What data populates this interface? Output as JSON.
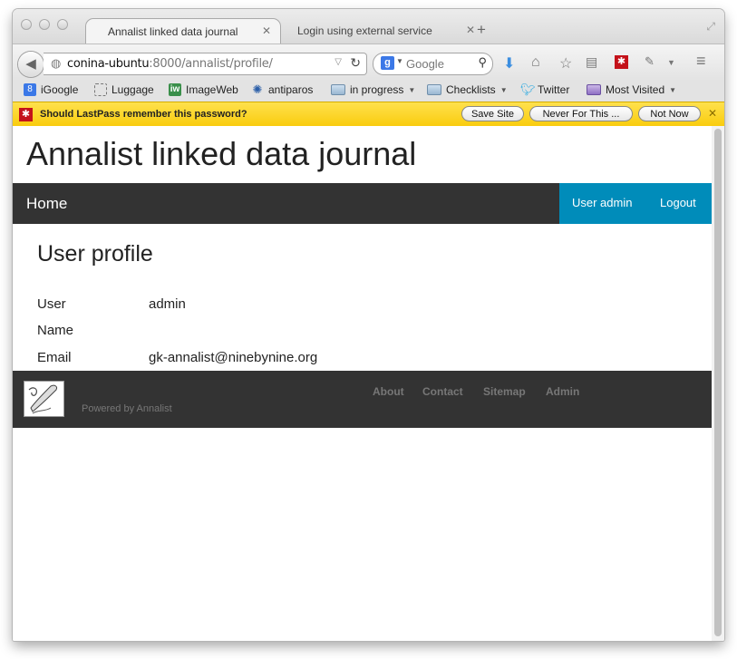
{
  "browser": {
    "tabs": [
      {
        "label": "Annalist linked data journal",
        "active": true
      },
      {
        "label": "Login using external service",
        "active": false
      }
    ],
    "url_host": "conina-ubuntu",
    "url_rest": ":8000/annalist/profile/",
    "search_placeholder": "Google",
    "search_engine_badge": "g"
  },
  "bookmarks": [
    {
      "label": "iGoogle",
      "icon": "igoogle-icon"
    },
    {
      "label": "Luggage",
      "icon": "luggage-icon"
    },
    {
      "label": "ImageWeb",
      "icon": "imageweb-icon"
    },
    {
      "label": "antiparos",
      "icon": "antiparos-icon"
    },
    {
      "label": "in progress",
      "icon": "folder-icon"
    },
    {
      "label": "Checklists",
      "icon": "folder-icon"
    },
    {
      "label": "Twitter",
      "icon": "twitter-icon"
    },
    {
      "label": "Most Visited",
      "icon": "most-visited-icon"
    }
  ],
  "lastpass": {
    "message": "Should LastPass remember this password?",
    "buttons": [
      "Save Site",
      "Never For This ...",
      "Not Now"
    ]
  },
  "page": {
    "site_title": "Annalist linked data journal",
    "nav": {
      "home": "Home",
      "user_admin": "User admin",
      "logout": "Logout"
    },
    "heading": "User profile",
    "fields": [
      {
        "label": "User",
        "value": "admin"
      },
      {
        "label": "Name",
        "value": ""
      },
      {
        "label": "Email",
        "value": "gk-annalist@ninebynine.org"
      }
    ],
    "footer": {
      "powered": "Powered by Annalist",
      "links": [
        "About",
        "Contact",
        "Sitemap",
        "Admin"
      ]
    }
  },
  "colors": {
    "topbar": "#333333",
    "accent": "#008cba",
    "lastpass_bar": "#f9cc0e"
  }
}
